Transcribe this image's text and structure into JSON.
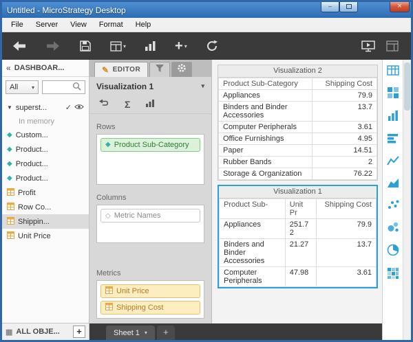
{
  "window": {
    "title": "Untitled - MicroStrategy Desktop"
  },
  "menu": {
    "items": [
      "File",
      "Server",
      "View",
      "Format",
      "Help"
    ]
  },
  "toolbar": {
    "icons": [
      "back",
      "forward",
      "save",
      "add-data",
      "insert-visualization",
      "add",
      "refresh",
      "presentation-mode",
      "window-layout"
    ]
  },
  "left_panel": {
    "header": "DASHBOAR...",
    "filter_value": "All",
    "dataset_label": "superst...",
    "dataset_status": "In memory",
    "attributes": [
      "Custom...",
      "Product...",
      "Product...",
      "Product..."
    ],
    "metrics": [
      "Profit",
      "Row Co...",
      "Shippin...",
      "Unit Price"
    ],
    "footer_label": "ALL OBJE...",
    "footer_add": "+"
  },
  "editor": {
    "tab_label": "EDITOR",
    "visualization_selector": "Visualization 1",
    "zones": {
      "rows": {
        "label": "Rows",
        "items": [
          "Product Sub-Category"
        ]
      },
      "columns": {
        "label": "Columns",
        "items": [
          "Metric Names"
        ]
      },
      "metrics": {
        "label": "Metrics",
        "items": [
          "Unit Price",
          "Shipping Cost"
        ]
      }
    }
  },
  "sheet_bar": {
    "tab": "Sheet 1",
    "add": "+"
  },
  "canvas": {
    "visualizations": [
      {
        "title": "Visualization 2",
        "columns": [
          "Product Sub-Category",
          "Shipping Cost"
        ],
        "rows": [
          [
            "Appliances",
            "79.9"
          ],
          [
            "Binders and Binder Accessories",
            "13.7"
          ],
          [
            "Computer Peripherals",
            "3.61"
          ],
          [
            "Office Furnishings",
            "4.95"
          ],
          [
            "Paper",
            "14.51"
          ],
          [
            "Rubber Bands",
            "2"
          ],
          [
            "Storage & Organization",
            "76.22"
          ]
        ]
      },
      {
        "title": "Visualization 1",
        "selected": true,
        "columns": [
          "Product Sub-",
          "Unit Pr",
          "Shipping Cost"
        ],
        "rows": [
          [
            "Appliances",
            "251.72",
            "79.9"
          ],
          [
            "Binders and Binder Accessories",
            "21.27",
            "13.7"
          ],
          [
            "Computer Peripherals",
            "47.98",
            "3.61"
          ]
        ]
      }
    ]
  },
  "gallery": {
    "icons": [
      "table-icon",
      "grid-icon",
      "bar-chart-icon",
      "horizontal-bar-icon",
      "line-chart-icon",
      "area-chart-icon",
      "scatter-icon",
      "bubble-icon",
      "pie-chart-icon",
      "heatmap-icon"
    ]
  },
  "colors": {
    "titlebar": "#2e6cb2",
    "accent_blue": "#2e9fd6",
    "attribute_teal": "#2fb3a8",
    "metric_orange": "#e8a33c",
    "pill_green": "#d9f2d9",
    "pill_amber": "#fdeec2"
  }
}
